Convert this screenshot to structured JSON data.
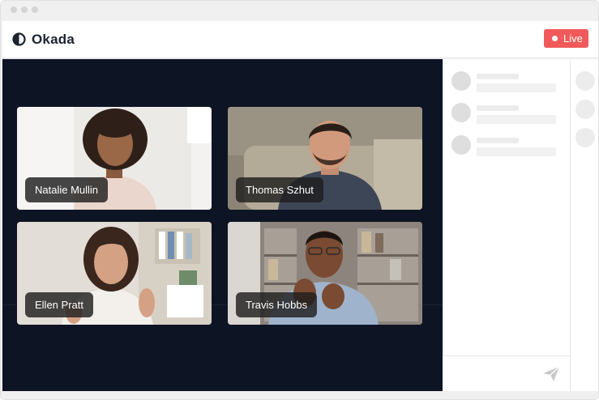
{
  "app": {
    "brand": "Okada",
    "logo_icon": "half-circle-logo-icon"
  },
  "header": {
    "live_label": "Live",
    "live_color": "#f05a5a"
  },
  "stage": {
    "background": "#0d1424",
    "participants": [
      {
        "name": "Natalie Mullin"
      },
      {
        "name": "Thomas Szhut"
      },
      {
        "name": "Ellen Pratt"
      },
      {
        "name": "Travis Hobbs"
      }
    ]
  },
  "chat": {
    "messages_placeholder_count": 3,
    "send_icon": "paper-plane-send-icon"
  },
  "people_rail": {
    "avatar_placeholder_count": 3
  }
}
